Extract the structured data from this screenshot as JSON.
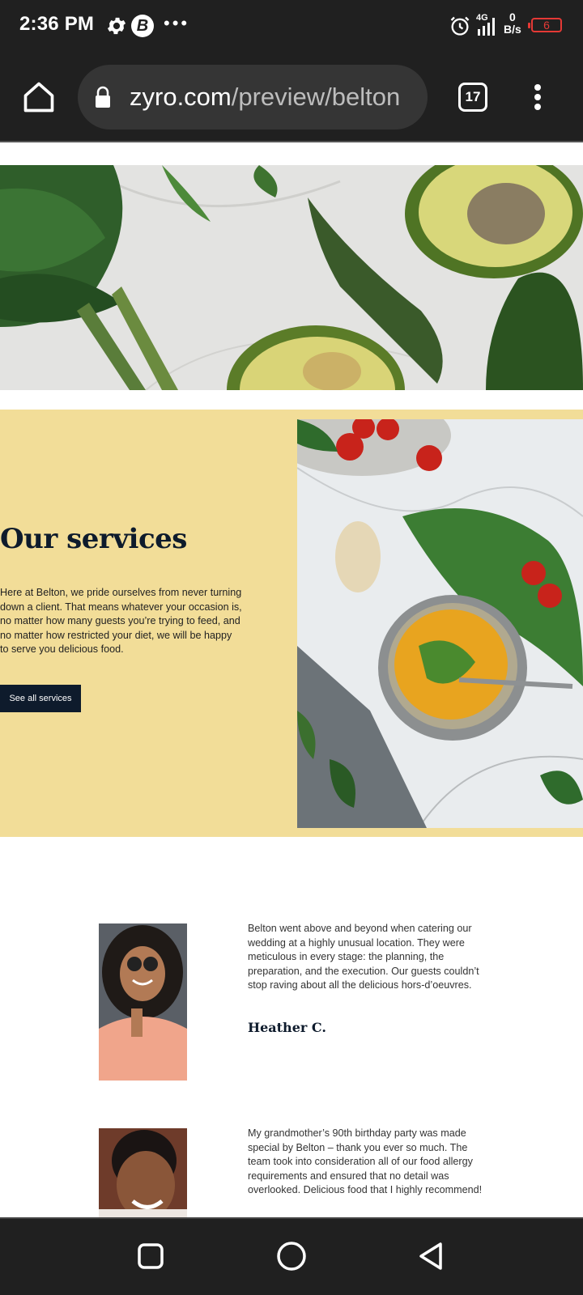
{
  "status_bar": {
    "time": "2:36 PM",
    "icons": [
      "gear-icon",
      "b-app-icon",
      "more-notifications-icon",
      "alarm-icon",
      "signal-4g-icon",
      "battery-icon"
    ],
    "network_type": "4G",
    "net_speed_value": "0",
    "net_speed_unit": "B/s",
    "battery_level": "6",
    "battery_color": "#e53935"
  },
  "browser": {
    "url_domain": "zyro.com",
    "url_path": "/preview/belton",
    "tab_count": "17",
    "icons": [
      "home-icon",
      "lock-icon",
      "tabs-icon",
      "overflow-menu-icon"
    ]
  },
  "page": {
    "services": {
      "title": "Our services",
      "body": "Here at Belton, we pride ourselves from never turning down a client. That means whatever your occasion is, no matter how many guests you’re trying to feed, and no matter how restricted your diet, we will be happy to serve you delicious food.",
      "button_label": "See all services",
      "background_color": "#f2dd98",
      "button_color": "#0e1b2c"
    },
    "testimonials": [
      {
        "quote": "Belton went above and beyond when catering our wedding at a highly unusual location. They were meticulous in every stage: the planning, the preparation, and the execution. Our guests couldn’t stop raving about all the delicious hors-d’oeuvres.",
        "name": "Heather C."
      },
      {
        "quote": "My grandmother’s 90th birthday party was made special by Belton – thank you ever so much. The team took into consideration all of our food allergy requirements and ensured that no detail was overlooked. Delicious food that I highly recommend!"
      }
    ]
  },
  "nav_bar": {
    "icons": [
      "recents-icon",
      "home-circle-icon",
      "back-icon"
    ]
  }
}
